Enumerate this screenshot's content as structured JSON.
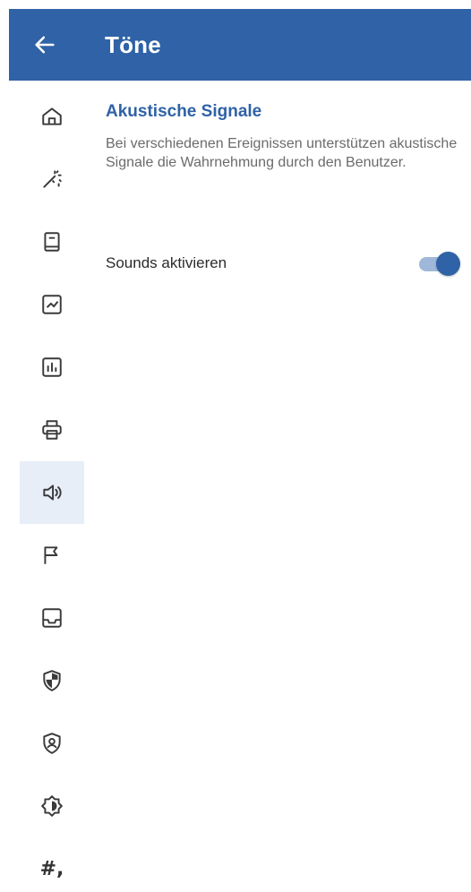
{
  "app_bar": {
    "title": "Töne",
    "back_icon": "arrow-left-icon",
    "background_color": "#2f62a6"
  },
  "navigation_rail": {
    "items": [
      {
        "name": "home",
        "icon": "home-icon",
        "active": false
      },
      {
        "name": "magic",
        "icon": "magic-wand-icon",
        "active": false
      },
      {
        "name": "book",
        "icon": "book-icon",
        "active": false
      },
      {
        "name": "chart-line",
        "icon": "chart-line-icon",
        "active": false
      },
      {
        "name": "chart-bar",
        "icon": "chart-bar-icon",
        "active": false
      },
      {
        "name": "print",
        "icon": "printer-icon",
        "active": false
      },
      {
        "name": "sound",
        "icon": "speaker-icon",
        "active": true
      },
      {
        "name": "flag",
        "icon": "flag-icon",
        "active": false
      },
      {
        "name": "inbox",
        "icon": "inbox-icon",
        "active": false
      },
      {
        "name": "security",
        "icon": "shield-icon",
        "active": false
      },
      {
        "name": "account",
        "icon": "user-shield-icon",
        "active": false
      },
      {
        "name": "brightness",
        "icon": "brightness-icon",
        "active": false
      },
      {
        "name": "number-format",
        "icon": "hash-icon",
        "label": "#,",
        "active": false
      }
    ]
  },
  "section": {
    "title": "Akustische Signale",
    "description": "Bei verschiedenen Ereignissen unterstützen akustische Signale die Wahrnehmung durch den Benutzer."
  },
  "settings": {
    "sounds": {
      "label": "Sounds aktivieren",
      "enabled": true,
      "accent_color": "#2f62a6"
    }
  }
}
